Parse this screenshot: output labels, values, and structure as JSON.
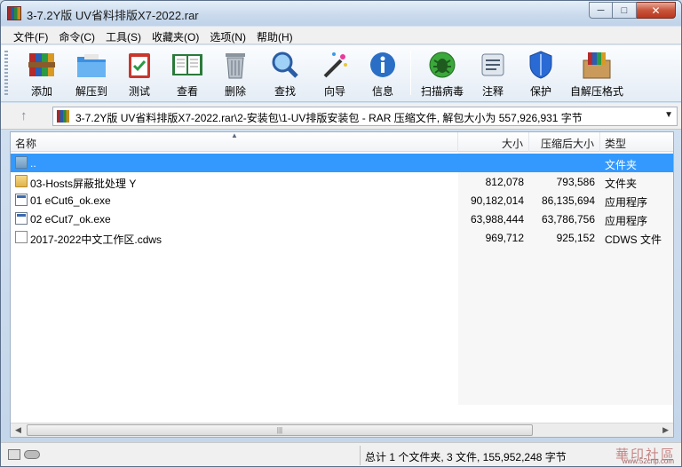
{
  "window": {
    "title": "3-7.2Y版 UV省料排版X7-2022.rar",
    "buttons": {
      "minimize": "─",
      "maximize": "□",
      "close": "✕"
    }
  },
  "menu": [
    "文件(F)",
    "命令(C)",
    "工具(S)",
    "收藏夹(O)",
    "选项(N)",
    "帮助(H)"
  ],
  "toolbar": [
    {
      "label": "添加",
      "icon": "add-archive-icon"
    },
    {
      "label": "解压到",
      "icon": "extract-folder-icon"
    },
    {
      "label": "测试",
      "icon": "test-clipboard-icon"
    },
    {
      "label": "查看",
      "icon": "view-book-icon"
    },
    {
      "label": "删除",
      "icon": "trash-icon"
    },
    {
      "label": "查找",
      "icon": "magnifier-icon"
    },
    {
      "label": "向导",
      "icon": "wizard-wand-icon"
    },
    {
      "label": "信息",
      "icon": "info-icon"
    },
    {
      "label": "扫描病毒",
      "icon": "virus-scan-icon"
    },
    {
      "label": "注释",
      "icon": "comment-icon"
    },
    {
      "label": "保护",
      "icon": "shield-icon"
    },
    {
      "label": "自解压格式",
      "icon": "sfx-box-icon"
    }
  ],
  "address": {
    "path": "3-7.2Y版 UV省料排版X7-2022.rar\\2-安装包\\1-UV排版安装包 - RAR 压缩文件, 解包大小为 557,926,931 字节"
  },
  "columns": {
    "name": "名称",
    "size": "大小",
    "packed": "压缩后大小",
    "type": "类型"
  },
  "files": [
    {
      "name": "..",
      "size": "",
      "packed": "",
      "type": "文件夹",
      "icon": "parent-folder-icon"
    },
    {
      "name": "03-Hosts屏蔽批处理  Y",
      "size": "812,078",
      "packed": "793,586",
      "type": "文件夹",
      "icon": "folder-icon"
    },
    {
      "name": "01 eCut6_ok.exe",
      "size": "90,182,014",
      "packed": "86,135,694",
      "type": "应用程序",
      "icon": "exe-icon"
    },
    {
      "name": "02 eCut7_ok.exe",
      "size": "63,988,444",
      "packed": "63,786,756",
      "type": "应用程序",
      "icon": "exe-icon"
    },
    {
      "name": "2017-2022中文工作区.cdws",
      "size": "969,712",
      "packed": "925,152",
      "type": "CDWS 文件",
      "icon": "document-icon"
    }
  ],
  "status": {
    "summary": "总计 1 个文件夹, 3 文件, 155,952,248 字节",
    "watermark": "華印社區",
    "watermark_url": "www.52cnp.com"
  }
}
